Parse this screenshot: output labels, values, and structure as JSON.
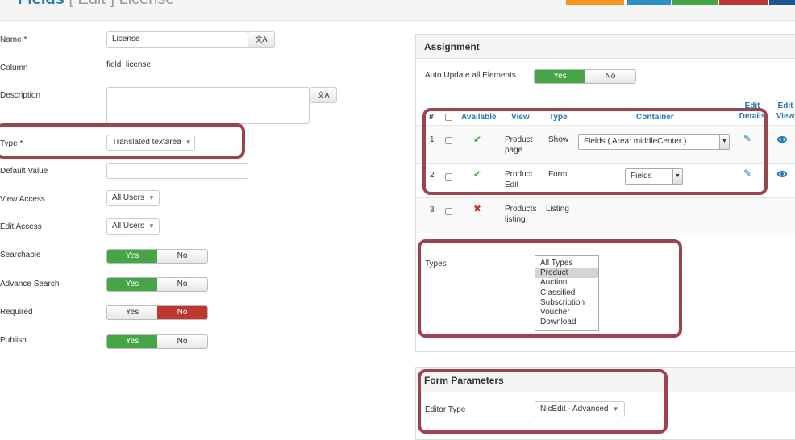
{
  "header": {
    "title_main": "Fields",
    "title_rest": "[ Edit ] License"
  },
  "colors": {
    "toolbar": [
      "#f7941d",
      "#2d8fc5",
      "#46a546",
      "#bd362f",
      "#1e5799"
    ],
    "highlight": "#9d4350",
    "accent": "#1e7bb8"
  },
  "form": {
    "name": {
      "label": "Name *",
      "value": "License"
    },
    "column": {
      "label": "Column",
      "value": "field_license"
    },
    "description": {
      "label": "Description",
      "value": ""
    },
    "type": {
      "label": "Type *",
      "value": "Translated textarea"
    },
    "default_value": {
      "label": "Default Value",
      "value": ""
    },
    "view_access": {
      "label": "View Access",
      "value": "All Users"
    },
    "edit_access": {
      "label": "Edit Access",
      "value": "All Users"
    },
    "searchable": {
      "label": "Searchable",
      "yes": "Yes",
      "no": "No",
      "selected": "yes"
    },
    "advance_search": {
      "label": "Advance Search",
      "yes": "Yes",
      "no": "No",
      "selected": "yes"
    },
    "required": {
      "label": "Required",
      "yes": "Yes",
      "no": "No",
      "selected": "no"
    },
    "publish": {
      "label": "Publish",
      "yes": "Yes",
      "no": "No",
      "selected": "yes"
    }
  },
  "assignment": {
    "title": "Assignment",
    "auto_update": {
      "label": "Auto Update all Elements",
      "yes": "Yes",
      "no": "No",
      "selected": "yes"
    },
    "columns": {
      "num": "#",
      "available": "Available",
      "view": "View",
      "type": "Type",
      "container": "Container",
      "edit_details": "Edit Details",
      "edit_view": "Edit View"
    },
    "rows": [
      {
        "num": "1",
        "available": true,
        "view": "Product page",
        "type": "Show",
        "container": "Fields ( Area: middleCenter )"
      },
      {
        "num": "2",
        "available": true,
        "view": "Product Edit",
        "type": "Form",
        "container": "Fields"
      },
      {
        "num": "3",
        "available": false,
        "view": "Products listing",
        "type": "Listing",
        "container": ""
      }
    ],
    "types": {
      "label": "Types",
      "options": [
        "All Types",
        "Product",
        "Auction",
        "Classified",
        "Subscription",
        "Voucher",
        "Download"
      ],
      "selected": "Product"
    }
  },
  "form_parameters": {
    "title": "Form Parameters",
    "editor_type": {
      "label": "Editor Type",
      "value": "NicEdit - Advanced"
    }
  }
}
